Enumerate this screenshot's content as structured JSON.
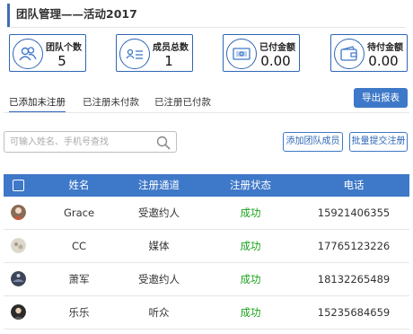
{
  "header": {
    "title": "团队管理——活动2017"
  },
  "stats": [
    {
      "label": "团队个数",
      "value": "5",
      "icon": "team-icon"
    },
    {
      "label": "成员总数",
      "value": "1",
      "icon": "member-list-icon"
    },
    {
      "label": "已付金额",
      "value": "0.00",
      "icon": "cash-icon"
    },
    {
      "label": "待付金额",
      "value": "0.00",
      "icon": "wallet-icon"
    }
  ],
  "tabs": [
    {
      "label": "已添加未注册"
    },
    {
      "label": "已注册未付款"
    },
    {
      "label": "已注册已付款"
    }
  ],
  "toolbar": {
    "export_label": "导出报表",
    "add_member_label": "添加团队成员",
    "batch_submit_label": "批量提交注册"
  },
  "search": {
    "placeholder": "可输入姓名、手机号查找",
    "value": ""
  },
  "table": {
    "columns": [
      "姓名",
      "注册通道",
      "注册状态",
      "电话"
    ],
    "rows": [
      {
        "name": "Grace",
        "channel": "受邀约人",
        "status": "成功",
        "phone": "15921406355"
      },
      {
        "name": "CC",
        "channel": "媒体",
        "status": "成功",
        "phone": "17765123226"
      },
      {
        "name": "萧军",
        "channel": "受邀约人",
        "status": "成功",
        "phone": "18132265489"
      },
      {
        "name": "乐乐",
        "channel": "听众",
        "status": "成功",
        "phone": "15235684659"
      }
    ]
  },
  "colors": {
    "accent": "#3e78c8",
    "border": "#2e66b6",
    "success": "#1aa21a"
  }
}
